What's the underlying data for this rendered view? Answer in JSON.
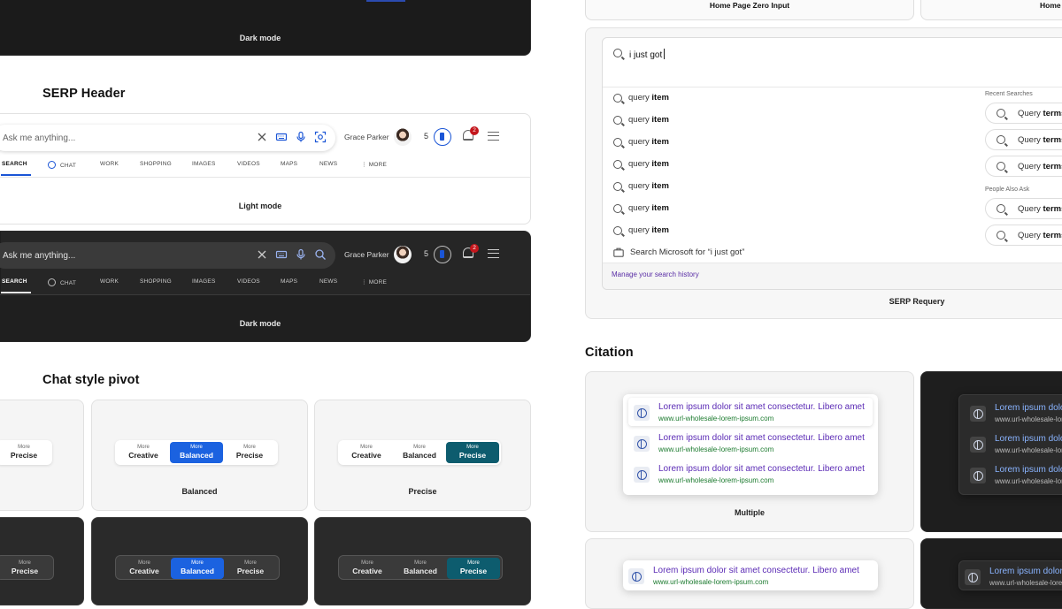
{
  "top": {
    "dark_mode_label": "Dark mode",
    "home_page_zero_input": "Home Page Zero Input",
    "home_cut": "Home"
  },
  "serp": {
    "section_title": "SERP Header",
    "placeholder": "Ask me anything...",
    "user_name": "Grace Parker",
    "points": "5",
    "notification_count": "2",
    "tabs": [
      "SEARCH",
      "CHAT",
      "WORK",
      "SHOPPING",
      "IMAGES",
      "VIDEOS",
      "MAPS",
      "NEWS",
      "MORE"
    ],
    "light_label": "Light mode",
    "dark_label": "Dark mode"
  },
  "pivot": {
    "section_title": "Chat style pivot",
    "more": "More",
    "options": [
      "Creative",
      "Balanced",
      "Precise"
    ],
    "balanced_label": "Balanced",
    "precise_label": "Precise",
    "accent_blue": "#1b62e0",
    "accent_teal": "#0d5c6e"
  },
  "requery": {
    "input_text": "i just got",
    "suggestions": [
      {
        "pre": "query ",
        "bold": "item"
      },
      {
        "pre": "query ",
        "bold": "item"
      },
      {
        "pre": "query ",
        "bold": "item"
      },
      {
        "pre": "query ",
        "bold": "item"
      },
      {
        "pre": "query ",
        "bold": "item"
      },
      {
        "pre": "query ",
        "bold": "item"
      },
      {
        "pre": "query ",
        "bold": "item"
      }
    ],
    "search_microsoft": "Search Microsoft for “i just got”",
    "recent_title": "Recent Searches",
    "people_title": "People Also Ask",
    "pill_pre": "Query ",
    "pill_bold": "terms",
    "manage_link": "Manage your search history",
    "label": "SERP Requery"
  },
  "citation": {
    "section_title": "Citation",
    "title": "Lorem ipsum dolor sit amet consectetur. Libero amet",
    "url": "www.url-wholesale-lorem-ipsum.com",
    "multiple_label": "Multiple"
  }
}
